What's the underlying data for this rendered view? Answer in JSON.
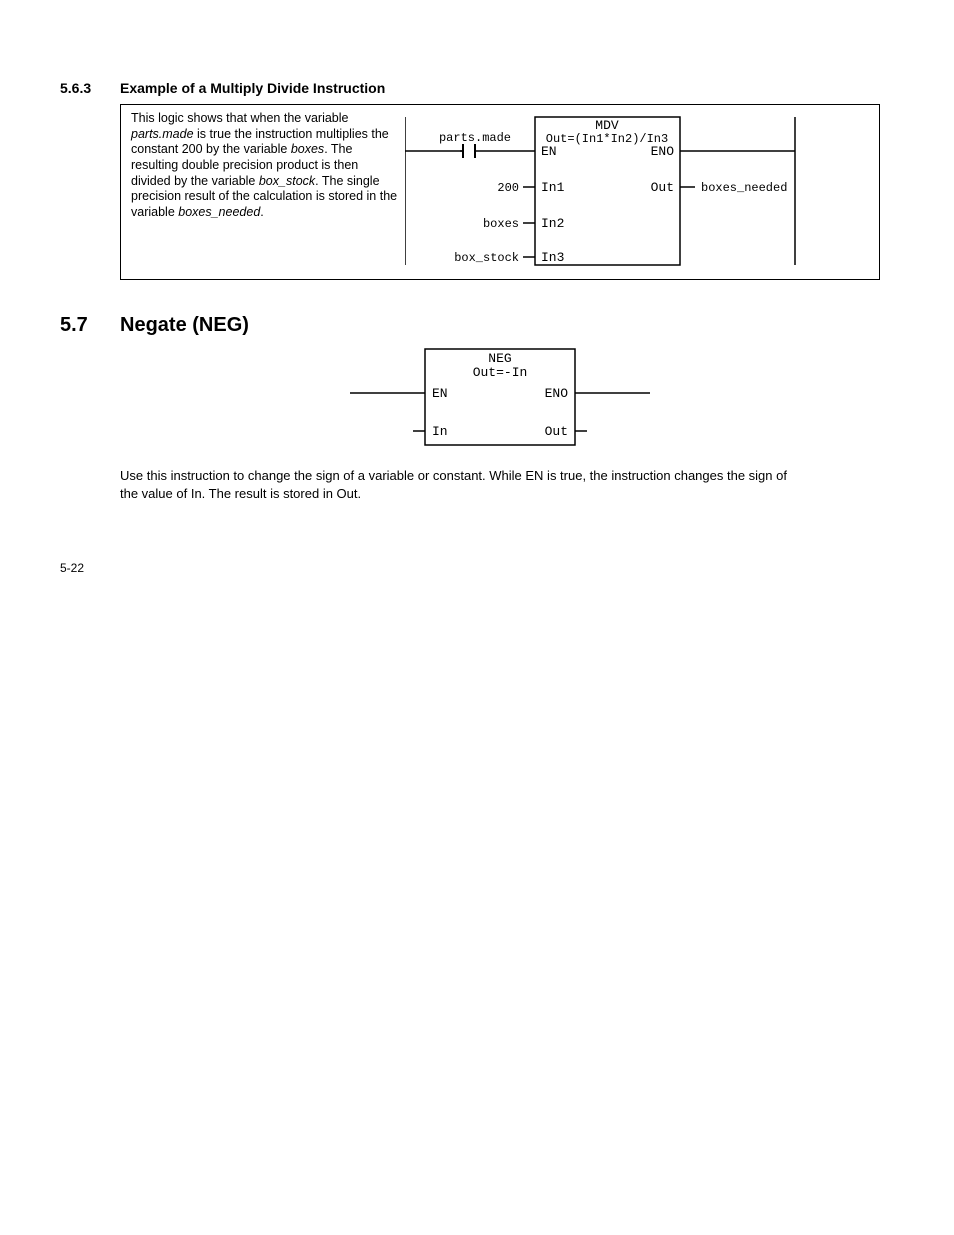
{
  "section563": {
    "number": "5.6.3",
    "title": "Example of a Multiply Divide Instruction",
    "para_pre": "This logic shows that when the variable ",
    "em1": "parts.made",
    "para_mid1": " is true the instruction multiplies the constant 200 by the variable ",
    "em2": "boxes",
    "para_mid2": ". The resulting double precision product is then divided by the variable ",
    "em3": "box_stock",
    "para_mid3": ". The single precision result of the calculation is stored in the variable ",
    "em4": "boxes_needed",
    "para_end": "."
  },
  "mdv_diagram": {
    "title": "MDV",
    "formula": "Out=(In1*In2)/In3",
    "en": "EN",
    "eno": "ENO",
    "in1": "In1",
    "in2": "In2",
    "in3": "In3",
    "out": "Out",
    "input_en_label": "parts.made",
    "input1_label": "200",
    "input2_label": "boxes",
    "input3_label": "box_stock",
    "output_label": "boxes_needed"
  },
  "section57": {
    "number": "5.7",
    "title": "Negate (NEG)"
  },
  "neg_diagram": {
    "title": "NEG",
    "formula": "Out=-In",
    "en": "EN",
    "eno": "ENO",
    "in": "In",
    "out": "Out"
  },
  "neg_para": "Use this instruction to change the sign of a variable or constant. While EN is true, the instruction changes the sign of the value of In. The result is stored in Out.",
  "page_number": "5-22"
}
